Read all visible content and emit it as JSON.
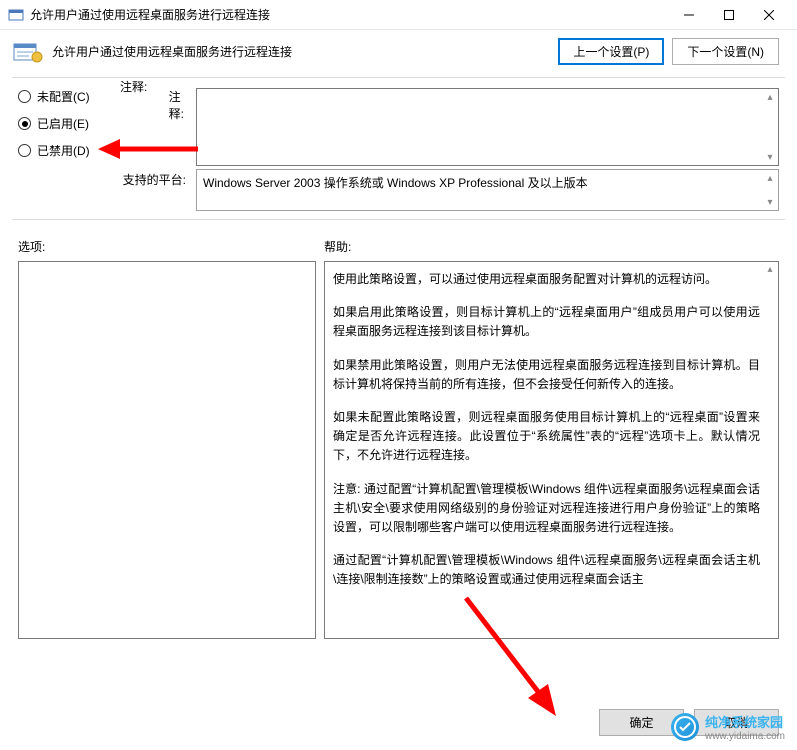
{
  "window": {
    "title": "允许用户通过使用远程桌面服务进行远程连接"
  },
  "header": {
    "title": "允许用户通过使用远程桌面服务进行远程连接",
    "prev_button": "上一个设置(P)",
    "next_button": "下一个设置(N)"
  },
  "radios": {
    "not_configured": "未配置(C)",
    "enabled": "已启用(E)",
    "disabled": "已禁用(D)"
  },
  "labels": {
    "notes": "注释:",
    "platform": "支持的平台:",
    "options": "选项:",
    "help": "帮助:"
  },
  "platform_text": "Windows Server 2003 操作系统或 Windows XP Professional 及以上版本",
  "help_paragraphs": [
    "使用此策略设置，可以通过使用远程桌面服务配置对计算机的远程访问。",
    "如果启用此策略设置，则目标计算机上的“远程桌面用户”组成员用户可以使用远程桌面服务远程连接到该目标计算机。",
    "如果禁用此策略设置，则用户无法使用远程桌面服务远程连接到目标计算机。目标计算机将保持当前的所有连接，但不会接受任何新传入的连接。",
    "如果未配置此策略设置，则远程桌面服务使用目标计算机上的“远程桌面”设置来确定是否允许远程连接。此设置位于“系统属性”表的“远程”选项卡上。默认情况下，不允许进行远程连接。",
    "注意: 通过配置“计算机配置\\管理模板\\Windows 组件\\远程桌面服务\\远程桌面会话主机\\安全\\要求使用网络级别的身份验证对远程连接进行用户身份验证”上的策略设置，可以限制哪些客户端可以使用远程桌面服务进行远程连接。",
    "通过配置“计算机配置\\管理模板\\Windows 组件\\远程桌面服务\\远程桌面会话主机\\连接\\限制连接数”上的策略设置或通过使用远程桌面会话主"
  ],
  "footer": {
    "ok": "确定",
    "cancel": "取消"
  },
  "watermark": {
    "name": "纯净系统家园",
    "url": "www.yidaima.com"
  }
}
